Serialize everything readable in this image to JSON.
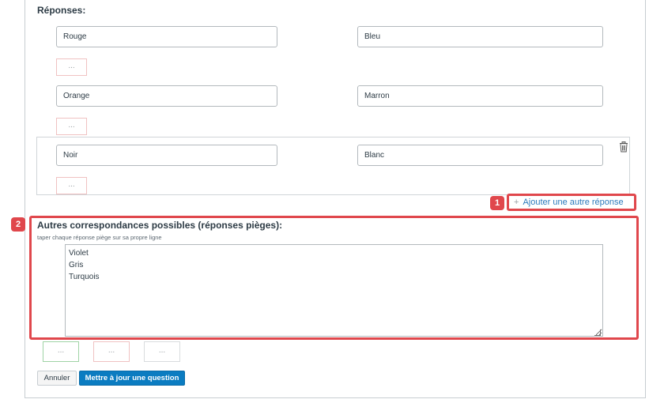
{
  "answers_section": {
    "title": "Réponses:",
    "pairs": [
      {
        "left": "Rouge",
        "right": "Bleu",
        "more": "..."
      },
      {
        "left": "Orange",
        "right": "Marron",
        "more": "..."
      },
      {
        "left": "Noir",
        "right": "Blanc",
        "more": "..."
      }
    ],
    "add_answer_label": "Ajouter une autre réponse",
    "add_icon": "+",
    "trash_icon": "trash-icon"
  },
  "callouts": {
    "one": "1",
    "two": "2"
  },
  "distractors": {
    "title": "Autres correspondances possibles (réponses pièges):",
    "hint": "taper chaque réponse piège sur sa propre ligne",
    "lines": [
      "Violet",
      "Gris",
      "Turquois"
    ]
  },
  "bottom_buttons": {
    "dots1": "...",
    "dots2": "...",
    "dots3": "..."
  },
  "actions": {
    "cancel": "Annuler",
    "update": "Mettre à jour une question"
  },
  "colors": {
    "highlight": "#e0474c",
    "primary": "#0b7cc1",
    "link": "#2b7abc"
  }
}
